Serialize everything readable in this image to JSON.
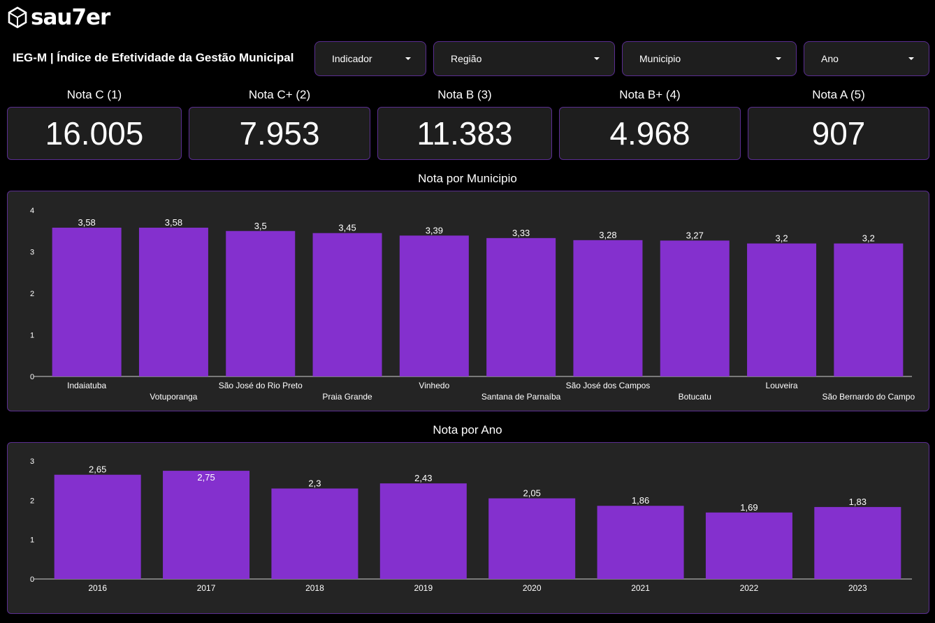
{
  "brand": {
    "logo_text": "sau7er"
  },
  "header": {
    "title": "IEG-M | Índice de Efetividade da Gestão Municipal"
  },
  "filters": [
    {
      "label": "Indicador"
    },
    {
      "label": "Região"
    },
    {
      "label": "Municipio"
    },
    {
      "label": "Ano"
    }
  ],
  "kpis": [
    {
      "label": "Nota C (1)",
      "value": "16.005"
    },
    {
      "label": "Nota C+ (2)",
      "value": "7.953"
    },
    {
      "label": "Nota B (3)",
      "value": "11.383"
    },
    {
      "label": "Nota B+ (4)",
      "value": "4.968"
    },
    {
      "label": "Nota A (5)",
      "value": "907"
    }
  ],
  "colors": {
    "bar": "#8430ce",
    "panel": "#242424",
    "border": "#5a2d91",
    "background": "#000000"
  },
  "chart_data": [
    {
      "type": "bar",
      "title": "Nota por Municipio",
      "categories": [
        "Indaiatuba",
        "Votuporanga",
        "São José do Rio Preto",
        "Praia Grande",
        "Vinhedo",
        "Santana de Parnaíba",
        "São José dos Campos",
        "Botucatu",
        "Louveira",
        "São Bernardo do Campo"
      ],
      "values": [
        3.58,
        3.58,
        3.5,
        3.45,
        3.39,
        3.33,
        3.28,
        3.27,
        3.2,
        3.2
      ],
      "value_labels": [
        "3,58",
        "3,58",
        "3,5",
        "3,45",
        "3,39",
        "3,33",
        "3,28",
        "3,27",
        "3,2",
        "3,2"
      ],
      "yticks": [
        "0",
        "1",
        "2",
        "3",
        "4"
      ],
      "ylim": [
        0,
        4
      ],
      "grid": false
    },
    {
      "type": "bar",
      "title": "Nota por Ano",
      "categories": [
        "2016",
        "2017",
        "2018",
        "2019",
        "2020",
        "2021",
        "2022",
        "2023"
      ],
      "values": [
        2.65,
        2.75,
        2.3,
        2.43,
        2.05,
        1.86,
        1.69,
        1.83
      ],
      "value_labels": [
        "2,65",
        "2,75",
        "2,3",
        "2,43",
        "2,05",
        "1,86",
        "1,69",
        "1,83"
      ],
      "yticks": [
        "0",
        "1",
        "2",
        "3"
      ],
      "ylim": [
        0,
        3
      ],
      "grid": false
    }
  ]
}
